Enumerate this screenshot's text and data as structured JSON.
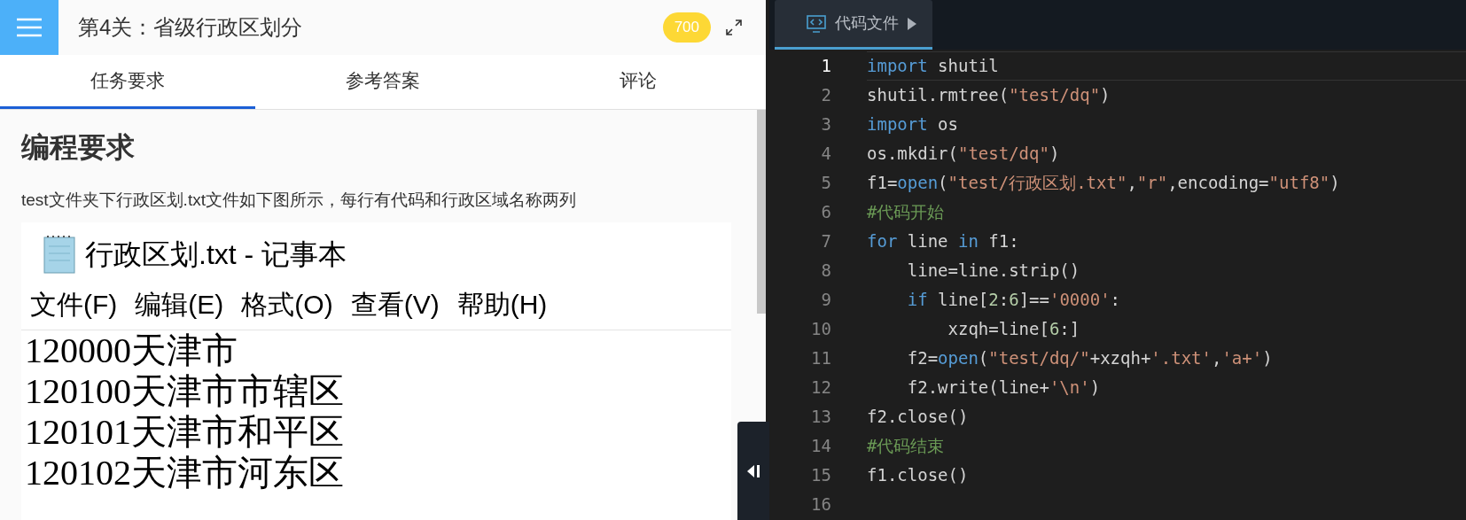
{
  "header": {
    "title": "第4关：省级行政区划分",
    "score": "700"
  },
  "tabs": [
    {
      "label": "任务要求",
      "selected": true
    },
    {
      "label": "参考答案",
      "selected": false
    },
    {
      "label": "评论",
      "selected": false
    }
  ],
  "task": {
    "heading": "编程要求",
    "paragraph": "test文件夹下行政区划.txt文件如下图所示，每行有代码和行政区域名称两列",
    "notepad": {
      "title": "行政区划.txt - 记事本",
      "menu": [
        "文件(F)",
        "编辑(E)",
        "格式(O)",
        "查看(V)",
        "帮助(H)"
      ],
      "lines": [
        "120000天津市",
        "120100天津市市辖区",
        "120101天津市和平区",
        "120102天津市河东区"
      ]
    }
  },
  "editor": {
    "file_tab": {
      "label": "代码文件",
      "selected": true
    },
    "lines": [
      {
        "number": "1",
        "current": true,
        "tokens": [
          {
            "kind": "keyword",
            "text": "import"
          },
          {
            "kind": "plain",
            "text": " shutil"
          }
        ]
      },
      {
        "number": "2",
        "current": false,
        "tokens": [
          {
            "kind": "plain",
            "text": "shutil.rmtree("
          },
          {
            "kind": "string",
            "text": "\"test/dq\""
          },
          {
            "kind": "plain",
            "text": ")"
          }
        ]
      },
      {
        "number": "3",
        "current": false,
        "tokens": [
          {
            "kind": "keyword",
            "text": "import"
          },
          {
            "kind": "plain",
            "text": " os"
          }
        ]
      },
      {
        "number": "4",
        "current": false,
        "tokens": [
          {
            "kind": "plain",
            "text": "os.mkdir("
          },
          {
            "kind": "string",
            "text": "\"test/dq\""
          },
          {
            "kind": "plain",
            "text": ")"
          }
        ]
      },
      {
        "number": "5",
        "current": false,
        "tokens": [
          {
            "kind": "plain",
            "text": "f1="
          },
          {
            "kind": "keyword",
            "text": "open"
          },
          {
            "kind": "plain",
            "text": "("
          },
          {
            "kind": "string",
            "text": "\"test/行政区划.txt\""
          },
          {
            "kind": "plain",
            "text": ","
          },
          {
            "kind": "string",
            "text": "\"r\""
          },
          {
            "kind": "plain",
            "text": ",encoding="
          },
          {
            "kind": "string",
            "text": "\"utf8\""
          },
          {
            "kind": "plain",
            "text": ")"
          }
        ]
      },
      {
        "number": "6",
        "current": false,
        "tokens": [
          {
            "kind": "comment",
            "text": "#代码开始"
          }
        ]
      },
      {
        "number": "7",
        "current": false,
        "tokens": [
          {
            "kind": "keyword",
            "text": "for"
          },
          {
            "kind": "plain",
            "text": " line "
          },
          {
            "kind": "keyword",
            "text": "in"
          },
          {
            "kind": "plain",
            "text": " f1:"
          }
        ]
      },
      {
        "number": "8",
        "current": false,
        "tokens": [
          {
            "kind": "plain",
            "text": "    line=line.strip()"
          }
        ]
      },
      {
        "number": "9",
        "current": false,
        "tokens": [
          {
            "kind": "keyword",
            "text": "    if"
          },
          {
            "kind": "plain",
            "text": " line["
          },
          {
            "kind": "number",
            "text": "2"
          },
          {
            "kind": "plain",
            "text": ":"
          },
          {
            "kind": "number",
            "text": "6"
          },
          {
            "kind": "plain",
            "text": "]=="
          },
          {
            "kind": "string",
            "text": "'0000'"
          },
          {
            "kind": "plain",
            "text": ":"
          }
        ]
      },
      {
        "number": "10",
        "current": false,
        "tokens": [
          {
            "kind": "plain",
            "text": "        xzqh=line["
          },
          {
            "kind": "number",
            "text": "6"
          },
          {
            "kind": "plain",
            "text": ":]"
          }
        ]
      },
      {
        "number": "11",
        "current": false,
        "tokens": [
          {
            "kind": "plain",
            "text": "    f2="
          },
          {
            "kind": "keyword",
            "text": "open"
          },
          {
            "kind": "plain",
            "text": "("
          },
          {
            "kind": "string",
            "text": "\"test/dq/\""
          },
          {
            "kind": "plain",
            "text": "+xzqh+"
          },
          {
            "kind": "string",
            "text": "'.txt'"
          },
          {
            "kind": "plain",
            "text": ","
          },
          {
            "kind": "string",
            "text": "'a+'"
          },
          {
            "kind": "plain",
            "text": ")"
          }
        ]
      },
      {
        "number": "12",
        "current": false,
        "tokens": [
          {
            "kind": "plain",
            "text": "    f2.write(line+"
          },
          {
            "kind": "string",
            "text": "'\\n'"
          },
          {
            "kind": "plain",
            "text": ")"
          }
        ]
      },
      {
        "number": "13",
        "current": false,
        "tokens": [
          {
            "kind": "plain",
            "text": "f2.close()"
          }
        ]
      },
      {
        "number": "14",
        "current": false,
        "tokens": [
          {
            "kind": "comment",
            "text": "#代码结束"
          }
        ]
      },
      {
        "number": "15",
        "current": false,
        "tokens": [
          {
            "kind": "plain",
            "text": "f1.close()"
          }
        ]
      },
      {
        "number": "16",
        "current": false
      }
    ]
  }
}
